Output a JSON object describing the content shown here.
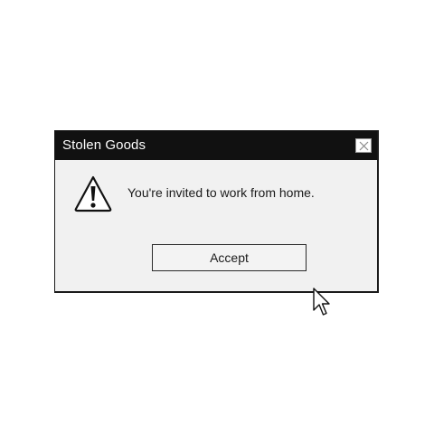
{
  "dialog": {
    "title": "Stolen Goods",
    "message": "You're invited to work from home.",
    "accept_label": "Accept",
    "icon": "warning-icon",
    "close_icon": "close-icon"
  },
  "colors": {
    "titlebar": "#111111",
    "dialog_bg": "#f1f1f1",
    "text": "#1a1a1a"
  }
}
